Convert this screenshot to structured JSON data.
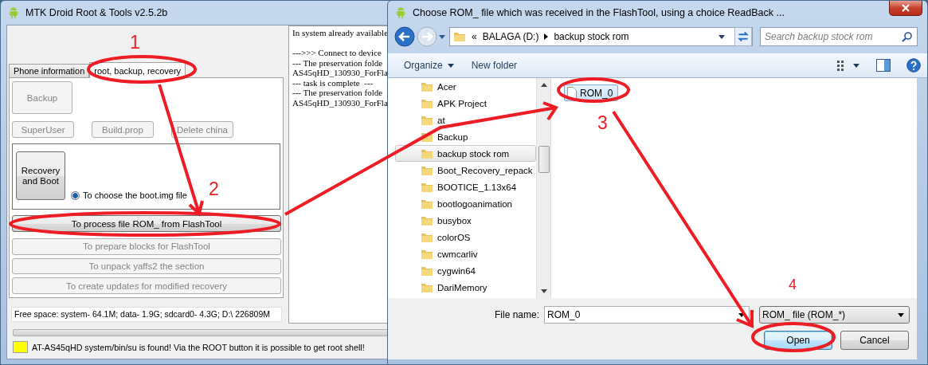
{
  "main_window": {
    "title": "MTK Droid Root & Tools v2.5.2b",
    "tabs": [
      {
        "label": "Phone information",
        "selected": false
      },
      {
        "label": "root, backup, recovery",
        "selected": true
      }
    ],
    "backup_button": {
      "label": "Backup",
      "disabled": true
    },
    "small_buttons": [
      {
        "label": "SuperUser",
        "disabled": true
      },
      {
        "label": "Build.prop",
        "disabled": true
      },
      {
        "label": "Delete china",
        "disabled": true
      }
    ],
    "recovery_button": {
      "label": "Recovery and Boot",
      "disabled": false
    },
    "radio": {
      "label": "To choose the boot.img file",
      "selected": true
    },
    "action_buttons": [
      {
        "label": "To process file ROM_ from FlashTool",
        "disabled": false
      },
      {
        "label": "To prepare blocks for FlashTool",
        "disabled": true
      },
      {
        "label": "To unpack yaffs2 the section",
        "disabled": true
      },
      {
        "label": "To create updates for modified recovery",
        "disabled": true
      }
    ],
    "free_space": "Free space: system- 64.1M; data- 1.9G; sdcard0- 4.3G;  D:\\ 226809M",
    "log_lines": [
      "In system already available",
      "--->>> Connect to device",
      "--- The preservation folde",
      "AS45qHD_130930_ForFla",
      "--- task is complete  ---",
      "--- The preservation folde",
      "AS45qHD_130930_ForFla"
    ],
    "progress": {
      "level": 0
    },
    "status": {
      "color": "#ffff00",
      "text": "AT-AS45qHD system/bin/su is found! Via the ROOT button it is possible to get root shell!"
    }
  },
  "dialog": {
    "title": "Choose ROM_ file which was received in the FlashTool, using a choice ReadBack ...",
    "breadcrumb_overflow": "«",
    "breadcrumb": [
      "BALAGA (D:)",
      "backup stock rom"
    ],
    "search": {
      "placeholder": "Search backup stock rom"
    },
    "toolbar": [
      "Organize",
      "New folder"
    ],
    "folders": [
      {
        "name": "Acer",
        "selected": false
      },
      {
        "name": "APK Project",
        "selected": false
      },
      {
        "name": "at",
        "selected": false
      },
      {
        "name": "Backup",
        "selected": false
      },
      {
        "name": "backup stock rom",
        "selected": true
      },
      {
        "name": "Boot_Recovery_repack",
        "selected": false
      },
      {
        "name": "BOOTICE_1.13x64",
        "selected": false
      },
      {
        "name": "bootlogoanimation",
        "selected": false
      },
      {
        "name": "busybox",
        "selected": false
      },
      {
        "name": "colorOS",
        "selected": false
      },
      {
        "name": "cwmcarliv",
        "selected": false
      },
      {
        "name": "cygwin64",
        "selected": false
      },
      {
        "name": "DariMemory",
        "selected": false
      }
    ],
    "files": [
      {
        "name": "ROM_0",
        "selected": true
      }
    ],
    "file_name": {
      "label": "File name:",
      "value": "ROM_0"
    },
    "file_type": "ROM_ file (ROM_*)",
    "buttons": [
      {
        "label": "Open",
        "default": true
      },
      {
        "label": "Cancel",
        "default": false
      }
    ]
  },
  "annotations": [
    "1",
    "2",
    "3",
    "4"
  ]
}
